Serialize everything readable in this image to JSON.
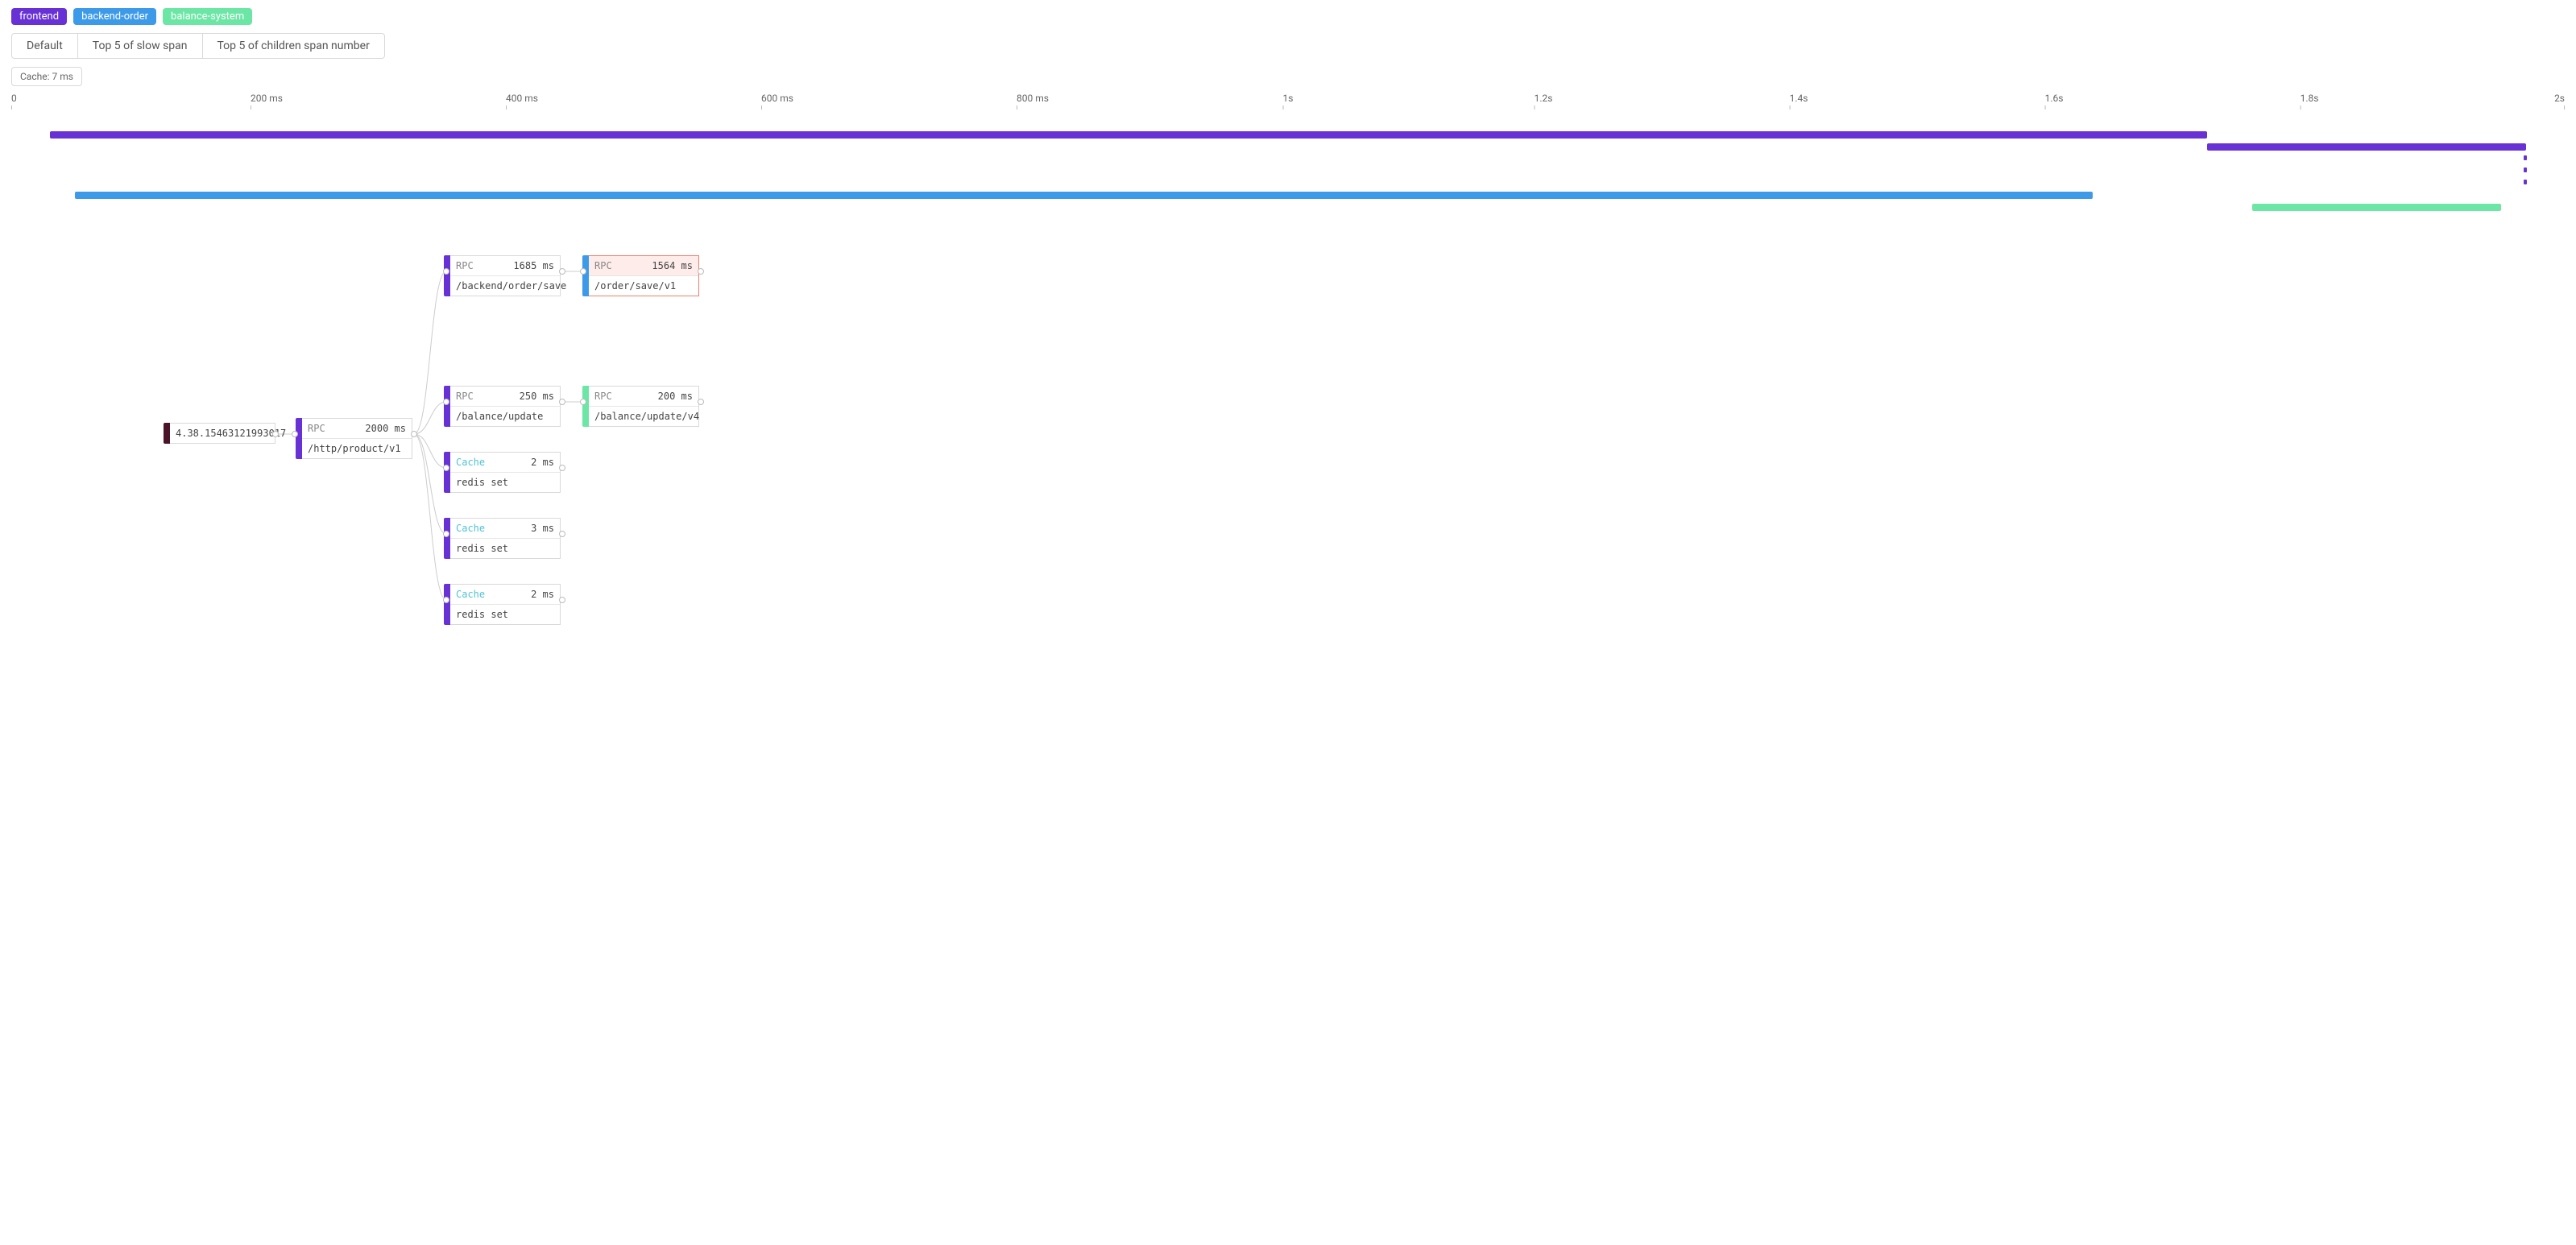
{
  "legend": {
    "frontend": "frontend",
    "backend_order": "backend-order",
    "balance_system": "balance-system"
  },
  "tabs": {
    "default": "Default",
    "slow": "Top 5 of slow span",
    "children": "Top 5 of children span number"
  },
  "chip": {
    "cache": "Cache: 7 ms"
  },
  "axis": {
    "ticks": [
      "0",
      "200 ms",
      "400 ms",
      "600 ms",
      "800 ms",
      "1s",
      "1.2s",
      "1.4s",
      "1.6s",
      "1.8s",
      "2s"
    ]
  },
  "colors": {
    "frontend": "#6831d6",
    "backend_order": "#3d9ae8",
    "balance_system": "#6be6a5"
  },
  "chart_data": {
    "type": "bar",
    "xlabel": "",
    "ylabel": "",
    "title": "",
    "x_range_ms": [
      0,
      2000
    ],
    "series": [
      {
        "name": "frontend",
        "color": "#6831d6",
        "start_ms": 30,
        "end_ms": 1720,
        "row": 0
      },
      {
        "name": "frontend",
        "color": "#6831d6",
        "start_ms": 1720,
        "end_ms": 1970,
        "row": 1
      },
      {
        "name": "frontend_dash1",
        "color": "#6831d6",
        "start_ms": 1968,
        "end_ms": 1972,
        "row": 2,
        "dashed": true
      },
      {
        "name": "frontend_dash2",
        "color": "#6831d6",
        "start_ms": 1968,
        "end_ms": 1972,
        "row": 3,
        "dashed": true
      },
      {
        "name": "frontend_dash3",
        "color": "#6831d6",
        "start_ms": 1968,
        "end_ms": 1972,
        "row": 4,
        "dashed": true
      },
      {
        "name": "backend-order",
        "color": "#3d9ae8",
        "start_ms": 50,
        "end_ms": 1630,
        "row": 5
      },
      {
        "name": "balance-system",
        "color": "#6be6a5",
        "start_ms": 1755,
        "end_ms": 1950,
        "row": 6
      }
    ]
  },
  "tree": {
    "root": {
      "path": "4.38.15463121993017"
    },
    "n1": {
      "type": "RPC",
      "duration": "2000 ms",
      "path": "/http/product/v1",
      "stripe": "#6831d6"
    },
    "n2": {
      "type": "RPC",
      "duration": "1685 ms",
      "path": "/backend/order/save",
      "stripe": "#6831d6"
    },
    "n3": {
      "type": "RPC",
      "duration": "1564 ms",
      "path": "/order/save/v1",
      "stripe": "#3d9ae8",
      "error": true
    },
    "n4": {
      "type": "RPC",
      "duration": "250 ms",
      "path": "/balance/update",
      "stripe": "#6831d6"
    },
    "n5": {
      "type": "RPC",
      "duration": "200 ms",
      "path": "/balance/update/v4",
      "stripe": "#6be6a5"
    },
    "n6": {
      "type": "Cache",
      "duration": "2 ms",
      "path": "redis set",
      "stripe": "#6831d6"
    },
    "n7": {
      "type": "Cache",
      "duration": "3 ms",
      "path": "redis set",
      "stripe": "#6831d6"
    },
    "n8": {
      "type": "Cache",
      "duration": "2 ms",
      "path": "redis set",
      "stripe": "#6831d6"
    }
  }
}
